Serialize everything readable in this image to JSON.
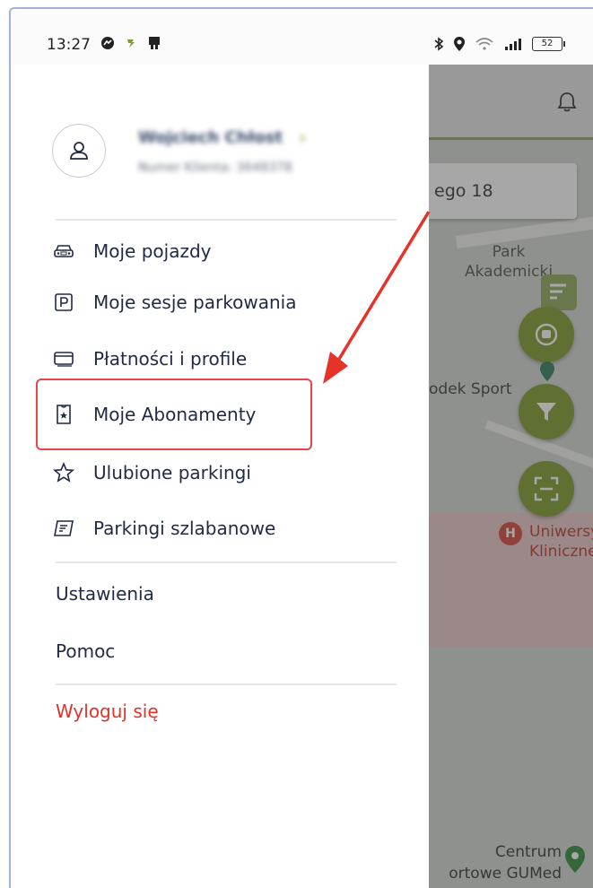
{
  "status_bar": {
    "time": "13:27",
    "battery": "52"
  },
  "profile": {
    "name": "Wojciech Chłost",
    "subtitle": "Numer Klienta: 3648378"
  },
  "menu": {
    "items": [
      {
        "label": "Moje pojazdy",
        "icon": "car-icon"
      },
      {
        "label": "Moje sesje parkowania",
        "icon": "parking-p-icon"
      },
      {
        "label": "Płatności i profile",
        "icon": "card-icon"
      },
      {
        "label": "Moje Abonamenty",
        "icon": "ticket-icon"
      },
      {
        "label": "Ulubione parkingi",
        "icon": "star-icon"
      },
      {
        "label": "Parkingi szlabanowe",
        "icon": "barrier-ticket-icon"
      }
    ],
    "settings_label": "Ustawienia",
    "help_label": "Pomoc",
    "logout_label": "Wyloguj się"
  },
  "map": {
    "search_text": "ego 18",
    "labels": {
      "park": "Park\nAkademicki",
      "sport": "odek Sport",
      "university": "Uniwersy\nKliniczne",
      "centrum": "Centrum\nortowe GUMed"
    }
  },
  "colors": {
    "accent_green": "#7c9b2a",
    "highlight_red": "#e5464b",
    "logout_red": "#e0322a",
    "text_dark": "#1f2a44"
  }
}
